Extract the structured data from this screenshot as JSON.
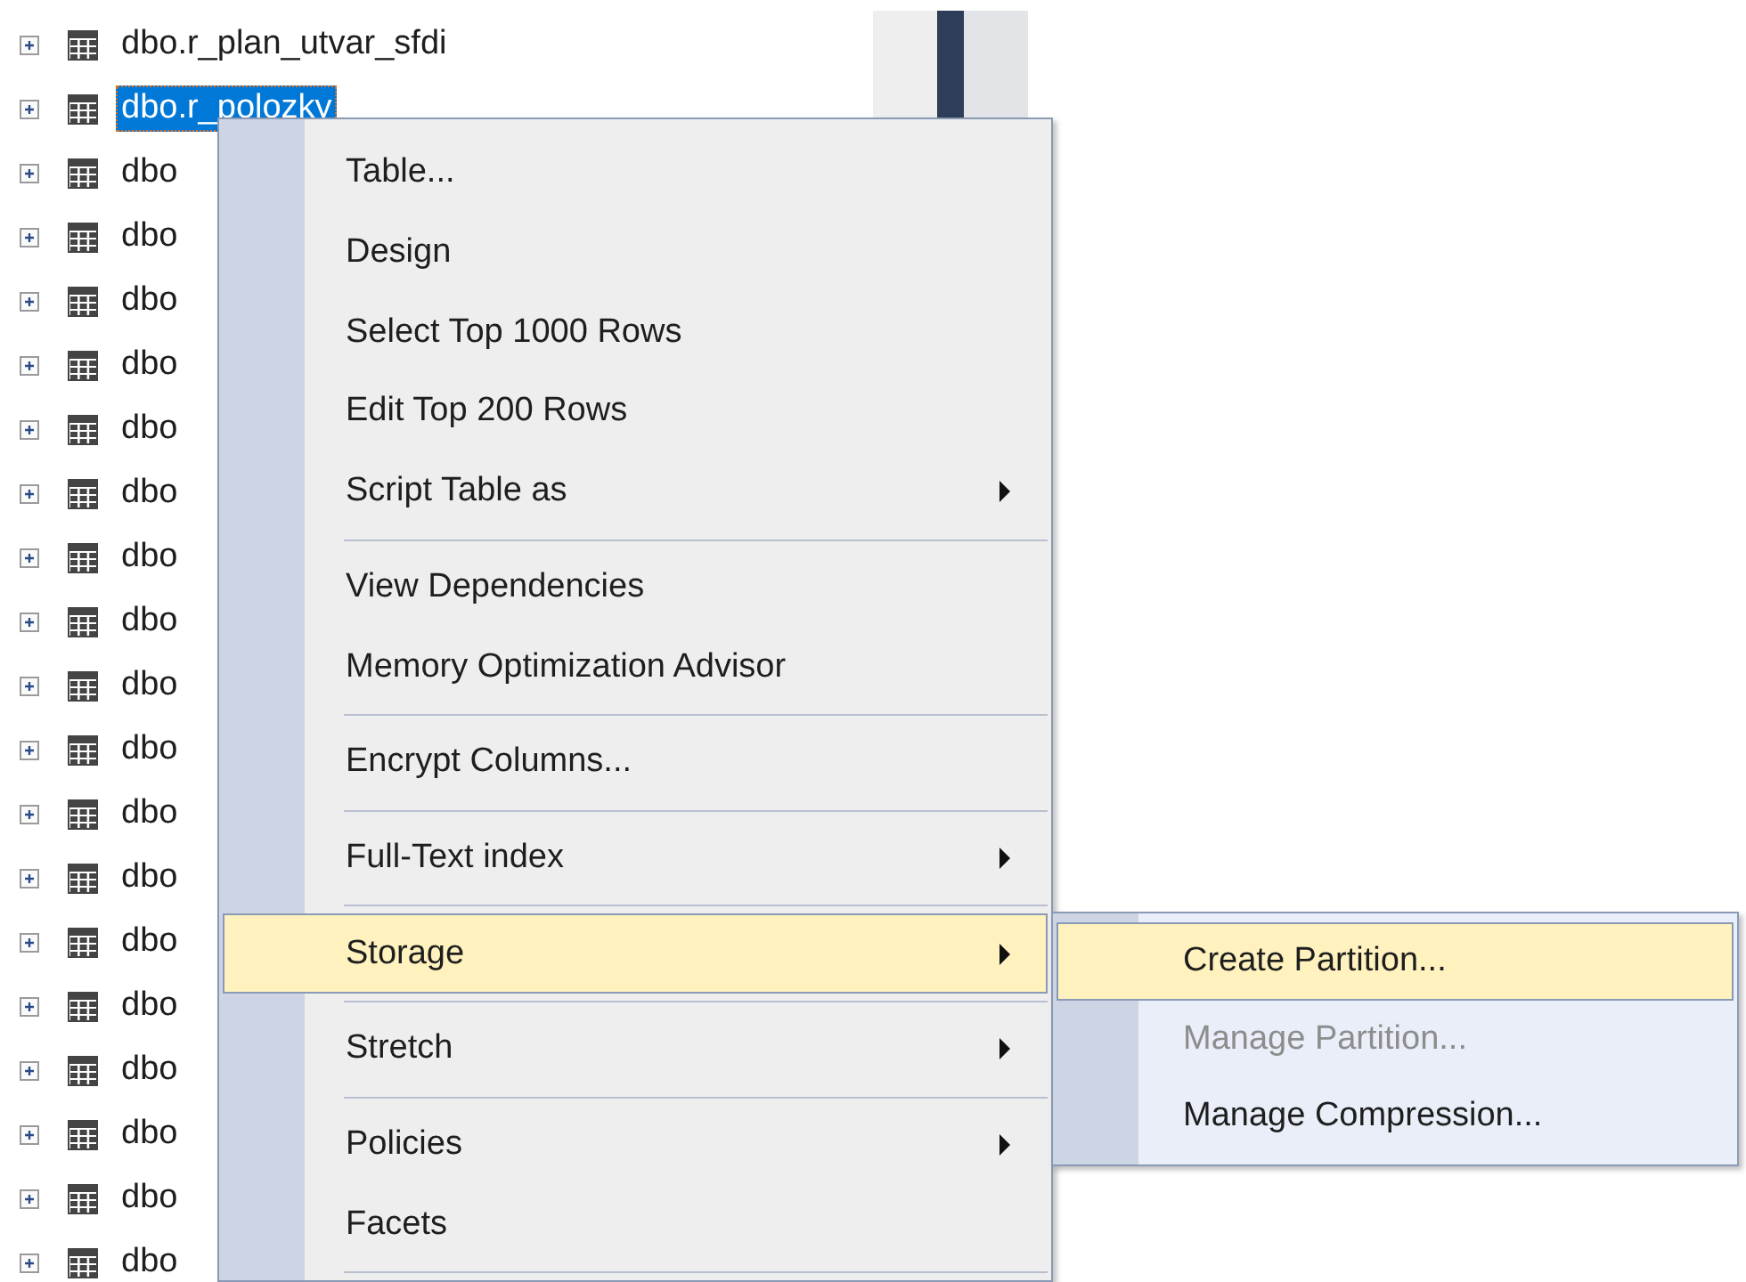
{
  "tree": {
    "rows": [
      {
        "label": "dbo.r_plan_utvar_sfdi",
        "selected": false,
        "expanded": false
      },
      {
        "label": "dbo.r_polozky",
        "selected": true,
        "expanded": false
      },
      {
        "label": "dbo",
        "selected": false,
        "expanded": false
      },
      {
        "label": "dbo",
        "selected": false,
        "expanded": false
      },
      {
        "label": "dbo",
        "selected": false,
        "expanded": false
      },
      {
        "label": "dbo",
        "selected": false,
        "expanded": false
      },
      {
        "label": "dbo",
        "selected": false,
        "expanded": false
      },
      {
        "label": "dbo",
        "selected": false,
        "expanded": false
      },
      {
        "label": "dbo",
        "selected": false,
        "expanded": false
      },
      {
        "label": "dbo",
        "selected": false,
        "expanded": false
      },
      {
        "label": "dbo",
        "selected": false,
        "expanded": false
      },
      {
        "label": "dbo",
        "selected": false,
        "expanded": false
      },
      {
        "label": "dbo",
        "selected": false,
        "expanded": false
      },
      {
        "label": "dbo",
        "selected": false,
        "expanded": false
      },
      {
        "label": "dbo",
        "selected": false,
        "expanded": false
      },
      {
        "label": "dbo",
        "selected": false,
        "expanded": false
      },
      {
        "label": "dbo",
        "selected": false,
        "expanded": false
      },
      {
        "label": "dbo",
        "selected": false,
        "expanded": false
      },
      {
        "label": "dbo",
        "selected": false,
        "expanded": false
      },
      {
        "label": "dbo",
        "selected": false,
        "expanded": false
      }
    ]
  },
  "context_menu": {
    "items": [
      {
        "kind": "item",
        "label": "Table...",
        "submenu": false,
        "highlighted": false
      },
      {
        "kind": "item",
        "label": "Design",
        "submenu": false,
        "highlighted": false
      },
      {
        "kind": "item",
        "label": "Select Top 1000 Rows",
        "submenu": false,
        "highlighted": false
      },
      {
        "kind": "item",
        "label": "Edit Top 200 Rows",
        "submenu": false,
        "highlighted": false
      },
      {
        "kind": "item",
        "label": "Script Table as",
        "submenu": true,
        "highlighted": false
      },
      {
        "kind": "separator"
      },
      {
        "kind": "item",
        "label": "View Dependencies",
        "submenu": false,
        "highlighted": false
      },
      {
        "kind": "item",
        "label": "Memory Optimization Advisor",
        "submenu": false,
        "highlighted": false
      },
      {
        "kind": "separator"
      },
      {
        "kind": "item",
        "label": "Encrypt Columns...",
        "submenu": false,
        "highlighted": false
      },
      {
        "kind": "separator"
      },
      {
        "kind": "item",
        "label": "Full-Text index",
        "submenu": true,
        "highlighted": false
      },
      {
        "kind": "separator"
      },
      {
        "kind": "item",
        "label": "Storage",
        "submenu": true,
        "highlighted": true
      },
      {
        "kind": "separator"
      },
      {
        "kind": "item",
        "label": "Stretch",
        "submenu": true,
        "highlighted": false
      },
      {
        "kind": "separator"
      },
      {
        "kind": "item",
        "label": "Policies",
        "submenu": true,
        "highlighted": false
      },
      {
        "kind": "item",
        "label": "Facets",
        "submenu": false,
        "highlighted": false
      },
      {
        "kind": "separator"
      }
    ]
  },
  "submenu": {
    "items": [
      {
        "label": "Create Partition...",
        "highlighted": true,
        "disabled": false
      },
      {
        "label": "Manage Partition...",
        "highlighted": false,
        "disabled": true
      },
      {
        "label": "Manage Compression...",
        "highlighted": false,
        "disabled": false
      }
    ]
  }
}
